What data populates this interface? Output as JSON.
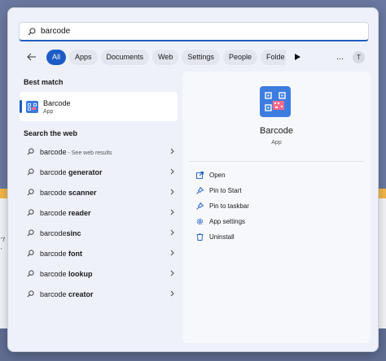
{
  "search": {
    "query": "barcode"
  },
  "filters": {
    "items": [
      "All",
      "Apps",
      "Documents",
      "Web",
      "Settings",
      "People",
      "Folde"
    ],
    "active": "All",
    "user_initial": "T",
    "more": "..."
  },
  "best_match": {
    "heading": "Best match",
    "name": "Barcode",
    "type": "App"
  },
  "web": {
    "heading": "Search the web",
    "items": [
      {
        "prefix": "barcode",
        "bold": "",
        "hint": " - See web results"
      },
      {
        "prefix": "barcode ",
        "bold": "generator",
        "hint": ""
      },
      {
        "prefix": "barcode ",
        "bold": "scanner",
        "hint": ""
      },
      {
        "prefix": "barcode ",
        "bold": "reader",
        "hint": ""
      },
      {
        "prefix": "barcode",
        "bold": "sinc",
        "hint": ""
      },
      {
        "prefix": "barcode ",
        "bold": "font",
        "hint": ""
      },
      {
        "prefix": "barcode ",
        "bold": "lookup",
        "hint": ""
      },
      {
        "prefix": "barcode ",
        "bold": "creator",
        "hint": ""
      }
    ]
  },
  "detail": {
    "name": "Barcode",
    "type": "App",
    "actions": [
      {
        "label": "Open",
        "icon": "open-icon"
      },
      {
        "label": "Pin to Start",
        "icon": "pin-icon"
      },
      {
        "label": "Pin to taskbar",
        "icon": "pin-icon"
      },
      {
        "label": "App settings",
        "icon": "gear-icon"
      },
      {
        "label": "Uninstall",
        "icon": "trash-icon"
      }
    ]
  },
  "background": {
    "text1": "'7",
    "text2": "'"
  },
  "colors": {
    "accent": "#1c5cc7",
    "app_icon": "#3d7ce0"
  }
}
